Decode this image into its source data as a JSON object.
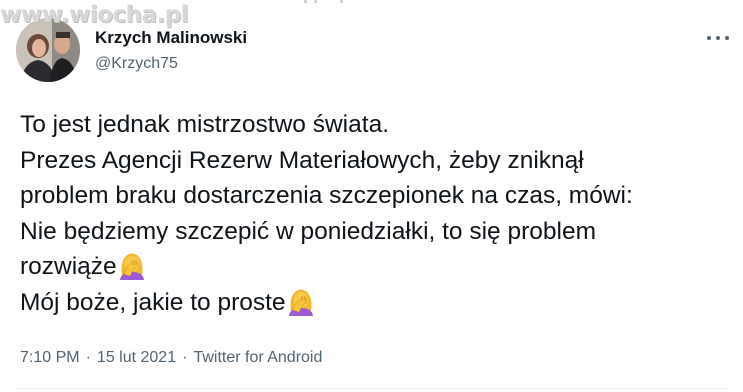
{
  "watermark": "www.wiocha.pl",
  "tweet": {
    "author_name": "Krzych Malinowski",
    "author_handle": "@Krzych75",
    "lines": [
      "To jest jednak mistrzostwo świata.",
      "Prezes Agencji Rezerw Materiałowych, żeby zniknął",
      "problem braku dostarczenia szczepionek na czas, mówi:",
      "Nie będziemy szczepić w poniedziałki, to się problem",
      "rozwiąże",
      "Mój boże, jakie to proste"
    ],
    "emoji": "woman-facepalming-icon",
    "time": "7:10 PM",
    "date": "15 lut 2021",
    "source": "Twitter for Android",
    "separator": "·"
  },
  "colors": {
    "text": "#0f1419",
    "secondary": "#536471",
    "watermark": "#d7d7d7",
    "emoji_hair": "#f7c53b",
    "emoji_shirt": "#9c5bd6",
    "emoji_skin": "#f9c94a"
  }
}
